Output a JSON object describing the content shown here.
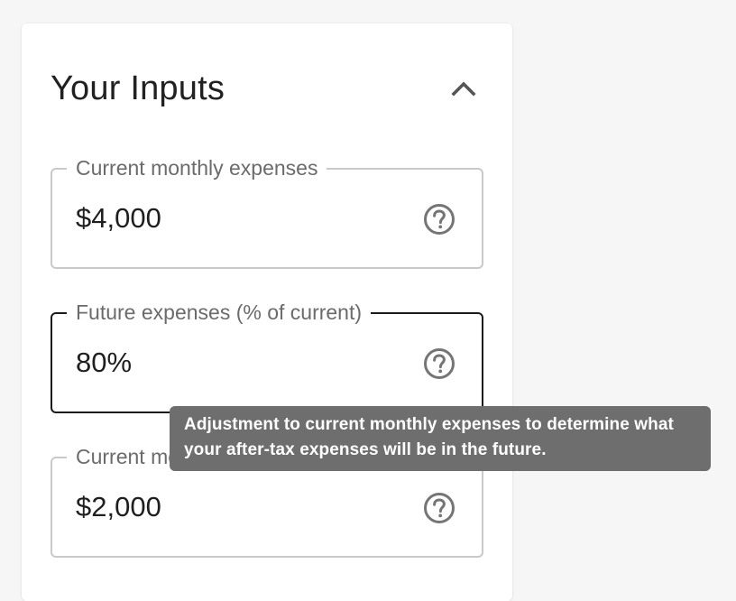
{
  "panel": {
    "title": "Your Inputs",
    "collapse_icon": "chevron-up-icon"
  },
  "fields": [
    {
      "label": "Current monthly expenses",
      "value": "$4,000",
      "help_icon": "help-circle-icon"
    },
    {
      "label": "Future expenses (% of current)",
      "value": "80%",
      "help_icon": "help-circle-icon",
      "focused": true
    },
    {
      "label": "Current monthly savings",
      "value": "$2,000",
      "help_icon": "help-circle-icon"
    }
  ],
  "tooltip": {
    "text": "Adjustment to current monthly expenses to determine what your after-tax expenses will be in the future."
  },
  "colors": {
    "background": "#f6f6f6",
    "card": "#ffffff",
    "field_border": "#c9c9c9",
    "field_border_focused": "#1b1b1b",
    "label": "#6b6b6b",
    "icon": "#757575",
    "tooltip_bg": "#6e6e6e"
  }
}
